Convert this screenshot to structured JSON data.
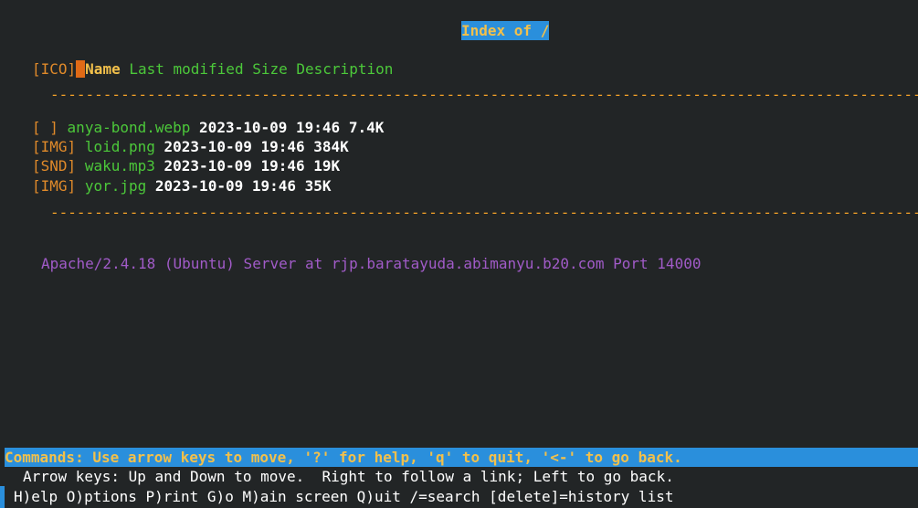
{
  "title": "Index of /",
  "table_header": {
    "icon_label": "[ICO]",
    "name_label": "Name",
    "modified_label": "Last modified",
    "size_label": "Size",
    "description_label": "Description"
  },
  "separator": "------------------------------------------------------------------------------------------------------------------------------------------------",
  "files": [
    {
      "icon": "[ ]",
      "name": "anya-bond.webp",
      "date": "2023-10-09 19:46",
      "size": "7.4K"
    },
    {
      "icon": "[IMG]",
      "name": "loid.png",
      "date": "2023-10-09 19:46",
      "size": "384K"
    },
    {
      "icon": "[SND]",
      "name": "waku.mp3",
      "date": "2023-10-09 19:46",
      "size": "19K"
    },
    {
      "icon": "[IMG]",
      "name": "yor.jpg",
      "date": "2023-10-09 19:46",
      "size": "35K"
    }
  ],
  "server_signature": "Apache/2.4.18 (Ubuntu) Server at rjp.baratayuda.abimanyu.b20.com Port 14000",
  "status_bar": {
    "commands": "Commands: Use arrow keys to move, '?' for help, 'q' to quit, '<-' to go back.",
    "arrow_help": "Arrow keys: Up and Down to move.  Right to follow a link; Left to go back.",
    "key_help": "H)elp O)ptions P)rint G)o M)ain screen Q)uit /=search [delete]=history list"
  },
  "colors": {
    "background": "#222526",
    "highlight_bg": "#2a8fdc",
    "highlight_fg": "#f2c04b",
    "link": "#4cc83a",
    "icon": "#e08a2a",
    "signature": "#a15bc8"
  }
}
